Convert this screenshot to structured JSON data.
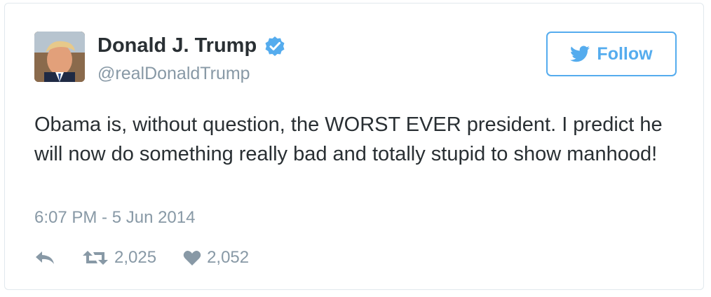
{
  "user": {
    "name": "Donald J. Trump",
    "handle": "@realDonaldTrump",
    "verified_icon": "verified-badge-icon",
    "avatar": "profile-photo"
  },
  "follow": {
    "label": "Follow",
    "icon": "twitter-bird-icon"
  },
  "tweet": {
    "text": "Obama is, without question, the WORST EVER president. I predict he will now do something really bad and totally stupid to show manhood!",
    "timestamp": "6:07 PM - 5 Jun 2014"
  },
  "actions": {
    "reply_icon": "reply-icon",
    "retweet_icon": "retweet-icon",
    "retweets": "2,025",
    "like_icon": "heart-icon",
    "likes": "2,052"
  },
  "colors": {
    "accent": "#55acee",
    "text": "#292f33",
    "muted": "#8899a6",
    "border": "#e1e8ed"
  }
}
